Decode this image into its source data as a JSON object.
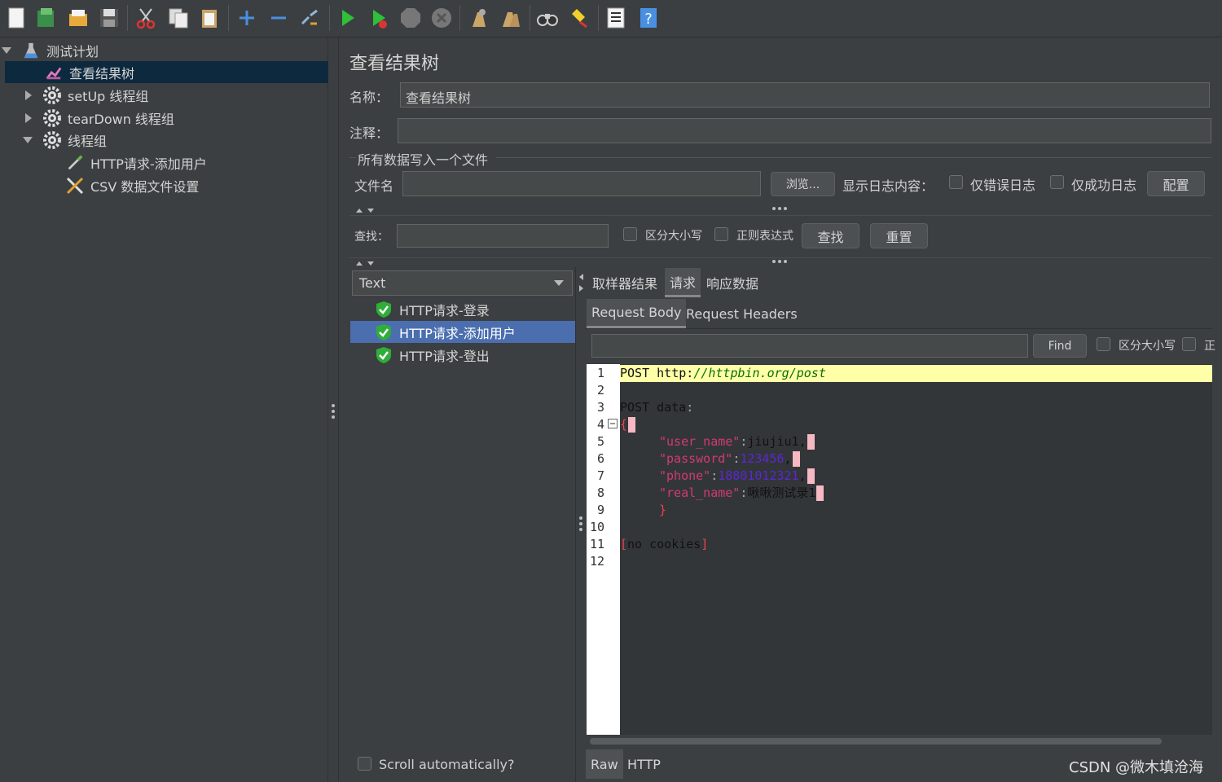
{
  "toolbar": {
    "icons": [
      "new-icon",
      "templates-icon",
      "open-icon",
      "save-icon",
      "cut-icon",
      "copy-icon",
      "paste-icon",
      "expand-icon",
      "collapse-icon",
      "toggle-icon",
      "start-icon",
      "start-no-pause-icon",
      "stop-icon",
      "shutdown-icon",
      "clear-icon",
      "clear-all-icon",
      "search-icon",
      "reset-search-icon",
      "function-helper-icon",
      "help-icon"
    ]
  },
  "tree": {
    "items": [
      {
        "label": "测试计划",
        "icon": "test-plan-icon"
      },
      {
        "label": "查看结果树",
        "icon": "result-tree-icon"
      },
      {
        "label": "setUp 线程组",
        "icon": "gear-icon"
      },
      {
        "label": "tearDown 线程组",
        "icon": "gear-icon"
      },
      {
        "label": "线程组",
        "icon": "gear-icon"
      },
      {
        "label": "HTTP请求-添加用户",
        "icon": "pipette-icon"
      },
      {
        "label": "CSV 数据文件设置",
        "icon": "tools-icon"
      }
    ]
  },
  "panel": {
    "title": "查看结果树",
    "name_label": "名称：",
    "name_value": "查看结果树",
    "comment_label": "注释：",
    "comment_value": "",
    "file_section": "所有数据写入一个文件",
    "filename_label": "文件名",
    "filename_value": "",
    "browse_button": "浏览...",
    "log_label": "显示日志内容：",
    "errors_only": "仅错误日志",
    "success_only": "仅成功日志",
    "configure_button": "配置",
    "search_label": "查找：",
    "search_value": "",
    "case_sensitive": "区分大小写",
    "regex": "正则表达式",
    "find_button": "查找",
    "reset_button": "重置"
  },
  "results": {
    "renderer": "Text",
    "items": [
      "HTTP请求-登录",
      "HTTP请求-添加用户",
      "HTTP请求-登出"
    ],
    "selected_index": 1,
    "scroll_label": "Scroll automatically?"
  },
  "tabs": {
    "main": [
      "取样器结果",
      "请求",
      "响应数据"
    ],
    "main_active": 1,
    "sub": [
      "Request Body",
      "Request Headers"
    ],
    "sub_active": 0,
    "find_button": "Find",
    "case_sensitive": "区分大小写",
    "regex_trunc": "正",
    "bottom": [
      "Raw",
      "HTTP"
    ],
    "bottom_active": 0
  },
  "code": {
    "line_numbers": [
      "1",
      "2",
      "3",
      "4",
      "5",
      "6",
      "7",
      "8",
      "9",
      "10",
      "11",
      "12"
    ],
    "l1_method": "POST ",
    "l1_scheme": "http:",
    "l1_url": "//httpbin.org/post",
    "l3": "POST data",
    "l3_colon": ":",
    "l4_brace": "{",
    "l5_key": "\"user_name\"",
    "l5_val": "jiujiu1,",
    "l6_key": "\"password\"",
    "l6_val": "123456",
    "l7_key": "\"phone\"",
    "l7_val": "18801012321",
    "l8_key": "\"real_name\"",
    "l8_val": "啾啾测试录1",
    "l9_brace": "}",
    "l11_open": "[",
    "l11_text": "no cookies",
    "l11_close": "]"
  },
  "watermark": "CSDN @微木填沧海"
}
